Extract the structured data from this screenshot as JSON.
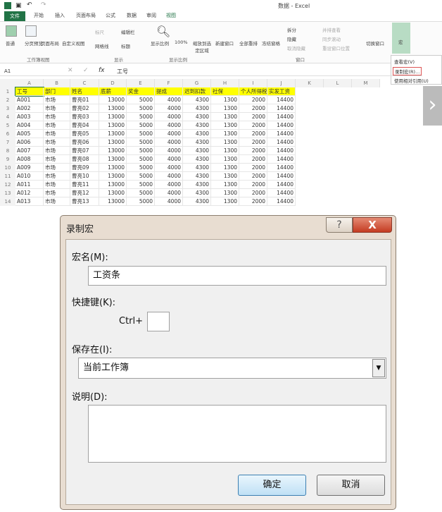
{
  "app": {
    "title": "数据 - Excel"
  },
  "tabs": [
    "文件",
    "开始",
    "插入",
    "页面布局",
    "公式",
    "数据",
    "审阅",
    "视图"
  ],
  "ribbon": {
    "buttons": [
      "普通",
      "分页预览",
      "页面布局",
      "自定义视图",
      "标尺",
      "编辑栏",
      "网格线",
      "标题",
      "显示比例",
      "100%",
      "缩放到选定区域",
      "新建窗口",
      "全部重排",
      "冻结窗格",
      "拆分",
      "隐藏",
      "取消隐藏",
      "并排查看",
      "同步滚动",
      "重设窗口位置",
      "切换窗口",
      "宏"
    ],
    "groups": [
      "工作簿视图",
      "显示",
      "显示比例",
      "窗口"
    ]
  },
  "macro_menu": [
    "查看宏(V)",
    "录制宏(R)...",
    "使用相对引用(U)"
  ],
  "formula_bar": {
    "name_box": "A1",
    "fx": "fx",
    "value": "工号"
  },
  "sheet": {
    "columns": [
      "A",
      "B",
      "C",
      "D",
      "E",
      "F",
      "G",
      "H",
      "I",
      "J",
      "K",
      "L",
      "M"
    ],
    "header": [
      "工号",
      "部门",
      "姓名",
      "底薪",
      "奖金",
      "提成",
      "迟到扣款",
      "社保",
      "个人所得税",
      "实发工资"
    ],
    "rows": [
      [
        "A001",
        "市场",
        "曹亮01",
        "13000",
        "5000",
        "4000",
        "4300",
        "1300",
        "2000",
        "14400"
      ],
      [
        "A002",
        "市场",
        "曹亮02",
        "13000",
        "5000",
        "4000",
        "4300",
        "1300",
        "2000",
        "14400"
      ],
      [
        "A003",
        "市场",
        "曹亮03",
        "13000",
        "5000",
        "4000",
        "4300",
        "1300",
        "2000",
        "14400"
      ],
      [
        "A004",
        "市场",
        "曹亮04",
        "13000",
        "5000",
        "4000",
        "4300",
        "1300",
        "2000",
        "14400"
      ],
      [
        "A005",
        "市场",
        "曹亮05",
        "13000",
        "5000",
        "4000",
        "4300",
        "1300",
        "2000",
        "14400"
      ],
      [
        "A006",
        "市场",
        "曹亮06",
        "13000",
        "5000",
        "4000",
        "4300",
        "1300",
        "2000",
        "14400"
      ],
      [
        "A007",
        "市场",
        "曹亮07",
        "13000",
        "5000",
        "4000",
        "4300",
        "1300",
        "2000",
        "14400"
      ],
      [
        "A008",
        "市场",
        "曹亮08",
        "13000",
        "5000",
        "4000",
        "4300",
        "1300",
        "2000",
        "14400"
      ],
      [
        "A009",
        "市场",
        "曹亮09",
        "13000",
        "5000",
        "4000",
        "4300",
        "1300",
        "2000",
        "14400"
      ],
      [
        "A010",
        "市场",
        "曹亮10",
        "13000",
        "5000",
        "4000",
        "4300",
        "1300",
        "2000",
        "14400"
      ],
      [
        "A011",
        "市场",
        "曹亮11",
        "13000",
        "5000",
        "4000",
        "4300",
        "1300",
        "2000",
        "14400"
      ],
      [
        "A012",
        "市场",
        "曹亮12",
        "13000",
        "5000",
        "4000",
        "4300",
        "1300",
        "2000",
        "14400"
      ],
      [
        "A013",
        "市场",
        "曹亮13",
        "13000",
        "5000",
        "4000",
        "4300",
        "1300",
        "2000",
        "14400"
      ]
    ],
    "header_color": "#ffff00"
  },
  "dialog": {
    "title": "录制宏",
    "help": "?",
    "close": "X",
    "macro_name_label": "宏名(M):",
    "macro_name_value": "工资条",
    "shortcut_label": "快捷键(K):",
    "ctrl": "Ctrl+",
    "shortcut_value": "",
    "store_label": "保存在(I):",
    "store_value": "当前工作簿",
    "desc_label": "说明(D):",
    "desc_value": "",
    "ok": "确定",
    "cancel": "取消"
  }
}
